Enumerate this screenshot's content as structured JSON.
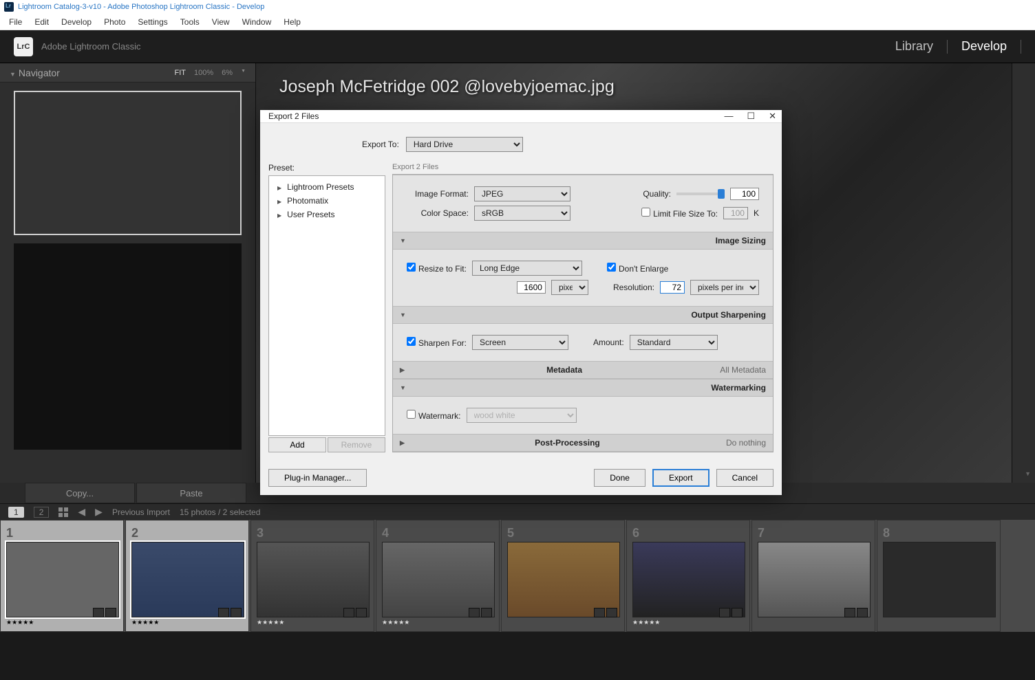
{
  "titlebar": "Lightroom Catalog-3-v10 - Adobe Photoshop Lightroom Classic - Develop",
  "menu": [
    "File",
    "Edit",
    "Develop",
    "Photo",
    "Settings",
    "Tools",
    "View",
    "Window",
    "Help"
  ],
  "header": {
    "app_icon": "LrC",
    "app_name": "Adobe Lightroom Classic",
    "modules": [
      "Library",
      "Develop"
    ],
    "active_module": "Develop"
  },
  "navigator": {
    "title": "Navigator",
    "zoom_modes": [
      "FIT",
      "100%",
      "6%"
    ],
    "active_zoom": "FIT"
  },
  "filename": "Joseph McFetridge 002 @lovebyjoemac.jpg",
  "actions": {
    "copy": "Copy...",
    "paste": "Paste"
  },
  "status": {
    "page_current": "1",
    "page_other": "2",
    "source": "Previous Import",
    "info": "15 photos / 2 selected"
  },
  "filmstrip": [
    {
      "num": "1",
      "rating": "★★★★★",
      "selected": true
    },
    {
      "num": "2",
      "rating": "★★★★★",
      "selected": true
    },
    {
      "num": "3",
      "rating": "★★★★★"
    },
    {
      "num": "4",
      "rating": "★★★★★"
    },
    {
      "num": "5",
      "rating": ""
    },
    {
      "num": "6",
      "rating": "★★★★★"
    },
    {
      "num": "7",
      "rating": ""
    },
    {
      "num": "8",
      "rating": ""
    }
  ],
  "dialog": {
    "title": "Export 2 Files",
    "export_to_label": "Export To:",
    "export_to_value": "Hard Drive",
    "preset_label": "Preset:",
    "presets": [
      "Lightroom Presets",
      "Photomatix",
      "User Presets"
    ],
    "preset_add": "Add",
    "preset_remove": "Remove",
    "settings_header": "Export 2 Files",
    "sections": {
      "file_settings": {
        "image_format_label": "Image Format:",
        "image_format": "JPEG",
        "quality_label": "Quality:",
        "quality": "100",
        "color_space_label": "Color Space:",
        "color_space": "sRGB",
        "limit_label": "Limit File Size To:",
        "limit": "100",
        "limit_unit": "K"
      },
      "image_sizing": {
        "title": "Image Sizing",
        "resize_label": "Resize to Fit:",
        "resize_mode": "Long Edge",
        "dont_enlarge": "Don't Enlarge",
        "size": "1600",
        "size_unit": "pixels",
        "resolution_label": "Resolution:",
        "resolution": "72",
        "resolution_unit": "pixels per inch"
      },
      "output_sharpening": {
        "title": "Output Sharpening",
        "sharpen_label": "Sharpen For:",
        "sharpen_for": "Screen",
        "amount_label": "Amount:",
        "amount": "Standard"
      },
      "metadata": {
        "title": "Metadata",
        "info": "All Metadata"
      },
      "watermarking": {
        "title": "Watermarking",
        "checkbox_label": "Watermark:",
        "preset": "wood white"
      },
      "post_processing": {
        "title": "Post-Processing",
        "info": "Do nothing"
      }
    },
    "footer": {
      "plugin": "Plug-in Manager...",
      "done": "Done",
      "export": "Export",
      "cancel": "Cancel"
    }
  }
}
